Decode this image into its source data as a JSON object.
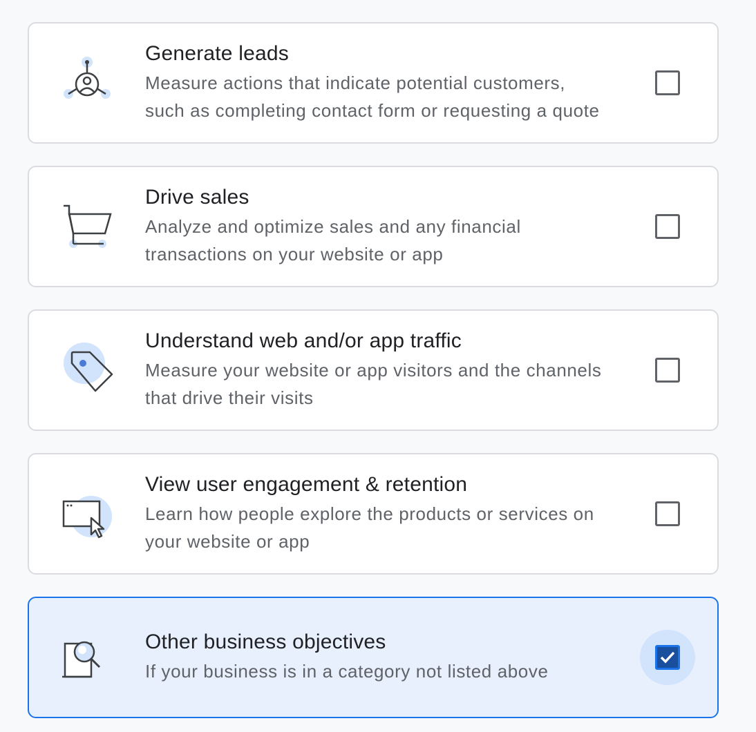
{
  "objectives": [
    {
      "title": "Generate leads",
      "description_line1": "Measure actions that indicate potential customers,",
      "description_line2": "such as completing contact form or requesting a quote",
      "icon": "lead-network-icon",
      "checked": false
    },
    {
      "title": "Drive sales",
      "description_line1": "Analyze and optimize sales and any financial",
      "description_line2": "transactions on your website or app",
      "icon": "shopping-cart-icon",
      "checked": false
    },
    {
      "title": "Understand web and/or app traffic",
      "description_line1": "Measure your website or app visitors and the channels",
      "description_line2": "that drive their visits",
      "icon": "tag-icon",
      "checked": false
    },
    {
      "title": "View user engagement & retention",
      "description_line1": "Learn how people explore the products or services on",
      "description_line2": "your website or app",
      "icon": "browser-cursor-icon",
      "checked": false
    },
    {
      "title": "Other business objectives",
      "description_line1": "If your business is in a category not listed above",
      "icon": "magnifier-document-icon",
      "checked": true
    }
  ],
  "colors": {
    "accent": "#1a73e8",
    "selected_background": "#e8f0fe",
    "icon_highlight": "#d2e3fc",
    "checkbox_checked_fill": "#1a4f9e"
  }
}
